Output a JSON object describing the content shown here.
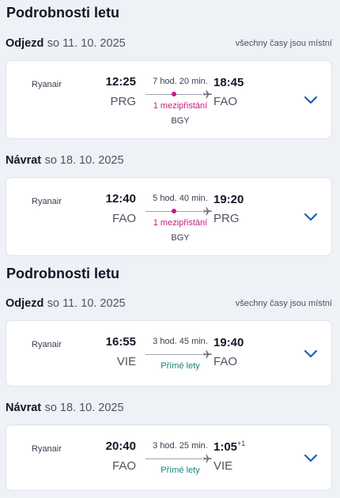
{
  "groups": [
    {
      "title": "Podrobnosti letu",
      "legs": [
        {
          "direction": "Odjezd",
          "date": "so 11. 10. 2025",
          "tz_note": "všechny časy jsou místní",
          "airline": "Ryanair",
          "dep_time": "12:25",
          "dep_code": "PRG",
          "duration": "7 hod. 20 min.",
          "stops": "1 mezipřistání",
          "via": "BGY",
          "arr_time": "18:45",
          "arr_day_offset": "",
          "arr_code": "FAO"
        },
        {
          "direction": "Návrat",
          "date": "so 18. 10. 2025",
          "tz_note": "",
          "airline": "Ryanair",
          "dep_time": "12:40",
          "dep_code": "FAO",
          "duration": "5 hod. 40 min.",
          "stops": "1 mezipřistání",
          "via": "BGY",
          "arr_time": "19:20",
          "arr_day_offset": "",
          "arr_code": "PRG"
        }
      ]
    },
    {
      "title": "Podrobnosti letu",
      "legs": [
        {
          "direction": "Odjezd",
          "date": "so 11. 10. 2025",
          "tz_note": "všechny časy jsou místní",
          "airline": "Ryanair",
          "dep_time": "16:55",
          "dep_code": "VIE",
          "duration": "3 hod. 45 min.",
          "stops": "Přímé lety",
          "via": "",
          "arr_time": "19:40",
          "arr_day_offset": "",
          "arr_code": "FAO"
        },
        {
          "direction": "Návrat",
          "date": "so 18. 10. 2025",
          "tz_note": "",
          "airline": "Ryanair",
          "dep_time": "20:40",
          "dep_code": "FAO",
          "duration": "3 hod. 25 min.",
          "stops": "Přímé lety",
          "via": "",
          "arr_time": "1:05",
          "arr_day_offset": "+1",
          "arr_code": "VIE"
        }
      ]
    }
  ],
  "icons": {
    "plane": "airplane-icon",
    "expand": "chevron-down-icon"
  },
  "colors": {
    "stop": "#c8197e",
    "direct": "#16857b",
    "chevron": "#1d5fb8"
  }
}
